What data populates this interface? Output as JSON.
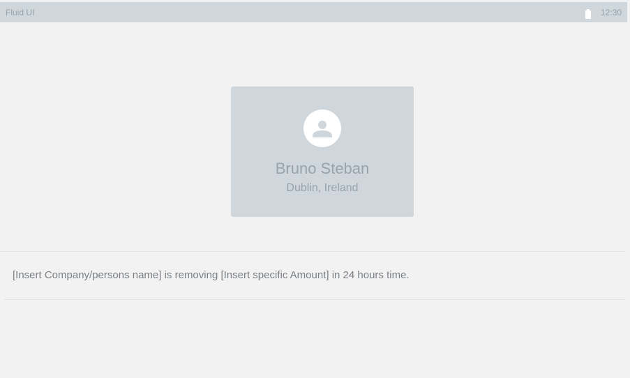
{
  "status_bar": {
    "app_name": "Fluid UI",
    "time": "12:30",
    "battery_icon": "battery-icon"
  },
  "profile": {
    "avatar_icon": "person-icon",
    "name": "Bruno Steban",
    "location": "Dublin, Ireland"
  },
  "notice": {
    "message": "[Insert Company/persons name] is removing [Insert specific Amount] in 24 hours time."
  },
  "colors": {
    "background": "#f2f2f2",
    "status_bar": "#d0d7dc",
    "card": "#cfd6dc",
    "muted_text": "#9aa2a9",
    "body_text": "#7a7f84"
  }
}
